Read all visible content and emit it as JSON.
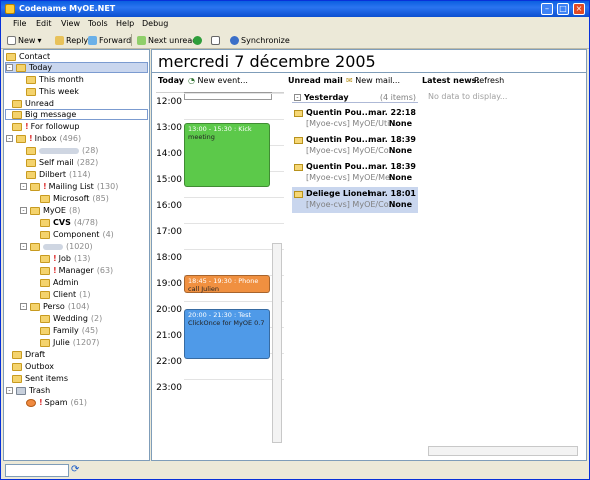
{
  "window": {
    "title": "Codename MyOE.NET"
  },
  "menu": [
    "File",
    "Edit",
    "View",
    "Tools",
    "Help",
    "Debug"
  ],
  "toolbar": {
    "new": "New",
    "reply": "Reply",
    "forward": "Forward",
    "next_unread": "Next unread",
    "sync": "Synchronize"
  },
  "tree": {
    "contact": "Contact",
    "today": "Today",
    "this_month": "This month",
    "this_week": "This week",
    "unread": "Unread",
    "big_message": "Big message",
    "for_followup": "For followup",
    "inbox": "Inbox",
    "inbox_count": "(496)",
    "blur1_count": "(28)",
    "self_mail": "Self mail",
    "self_mail_count": "(282)",
    "dilbert": "Dilbert",
    "dilbert_count": "(114)",
    "mailing_list": "Mailing List",
    "mailing_list_count": "(130)",
    "microsoft": "Microsoft",
    "microsoft_count": "(85)",
    "myoe": "MyOE",
    "myoe_count": "(8)",
    "cvs": "CVS",
    "cvs_count": "(4/78)",
    "component": "Component",
    "component_count": "(4)",
    "blur2_count": "(1020)",
    "job": "Job",
    "job_count": "(13)",
    "manager": "Manager",
    "manager_count": "(63)",
    "admin": "Admin",
    "client": "Client",
    "client_count": "(1)",
    "perso": "Perso",
    "perso_count": "(104)",
    "wedding": "Wedding",
    "wedding_count": "(2)",
    "family": "Family",
    "family_count": "(45)",
    "julie": "Julie",
    "julie_count": "(1207)",
    "draft": "Draft",
    "outbox": "Outbox",
    "sent_items": "Sent items",
    "trash": "Trash",
    "spam": "Spam",
    "spam_count": "(61)"
  },
  "main": {
    "date": "mercredi 7 décembre 2005",
    "today_label": "Today",
    "new_event": "New event...",
    "unread_label": "Unread mail",
    "new_mail": "New mail...",
    "news_label": "Latest news:",
    "refresh": "Refresh",
    "no_data": "No data to display...",
    "hours": [
      "12:00",
      "13:00",
      "14:00",
      "15:00",
      "16:00",
      "17:00",
      "18:00",
      "19:00",
      "20:00",
      "21:00",
      "22:00",
      "23:00"
    ],
    "events": [
      {
        "time": "13:00 - 15:30 : Kick",
        "title": "meeting",
        "color": "#5cc94a"
      },
      {
        "time": "18:45 - 19:30 : Phone",
        "title": "call Julien",
        "color": "#f09040"
      },
      {
        "time": "20:00 - 21:30 : Test",
        "title": "ClickOnce for MyOE 0.7",
        "color": "#4f9ae8"
      }
    ],
    "group": "Yesterday",
    "group_count": "(4 items)",
    "mails": [
      {
        "from": "Quentin Pou...",
        "time": "mar. 22:18",
        "subject": "[Myoe-cvs] MyOE/Uti...",
        "priority": "None"
      },
      {
        "from": "Quentin Pou...",
        "time": "mar. 18:39",
        "subject": "[Myoe-cvs] MyOE/Co...",
        "priority": "None"
      },
      {
        "from": "Quentin Pou...",
        "time": "mar. 18:39",
        "subject": "[Myoe-cvs] MyOE/Me...",
        "priority": "None"
      },
      {
        "from": "Deliege Lionel",
        "time": "mar. 18:01",
        "subject": "[Myoe-cvs] MyOE/Co...",
        "priority": "None"
      }
    ]
  }
}
